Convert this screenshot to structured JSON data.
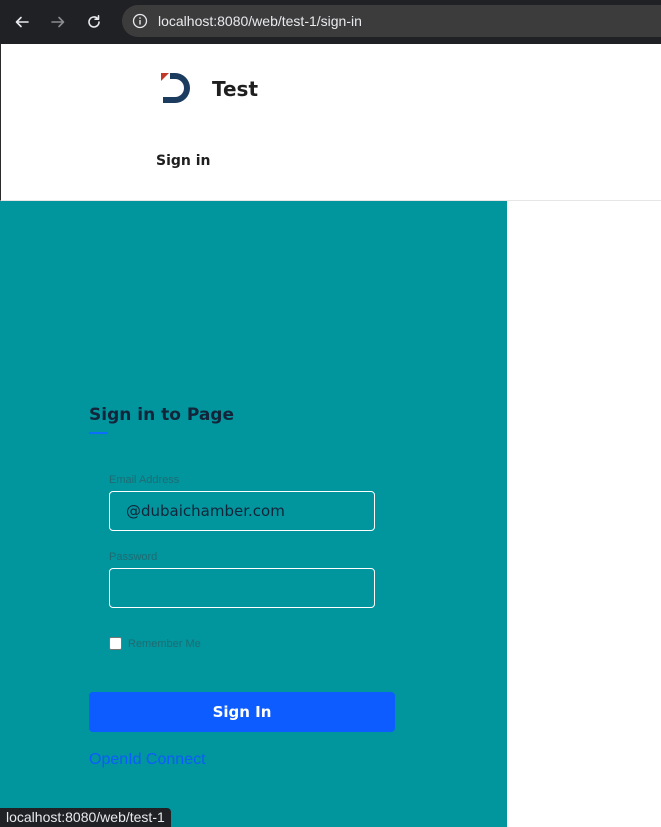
{
  "browser": {
    "url": "localhost:8080/web/test-1/sign-in",
    "status_url": "localhost:8080/web/test-1"
  },
  "site": {
    "brand": "Test",
    "nav_signin": "Sign in",
    "logo_colors": {
      "primary": "#1b3b5f",
      "accent": "#c0392b"
    }
  },
  "form": {
    "title": "Sign in to Page",
    "email_label": "Email Address",
    "email_value": "@dubaichamber.com",
    "password_label": "Password",
    "password_value": "",
    "remember_label": "Remember Me",
    "remember_checked": false,
    "submit_label": "Sign In",
    "openid_label": "OpenId Connect"
  },
  "colors": {
    "panel_bg": "#01959d",
    "button_bg": "#0d5cff"
  }
}
